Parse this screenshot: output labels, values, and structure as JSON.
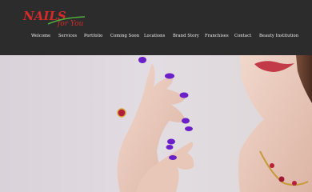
{
  "brand": {
    "logo_main": "NAILS",
    "logo_script": "for You",
    "colors": {
      "main": "#d42a2a",
      "script": "#4fae3c",
      "header_bg": "#2c2c2c"
    }
  },
  "nav": {
    "items": [
      {
        "label": "Welcome"
      },
      {
        "label": "Services"
      },
      {
        "label": "Portfolio"
      },
      {
        "label": "Coming Soon"
      },
      {
        "label": "Locations"
      },
      {
        "label": "Brand Story"
      },
      {
        "label": "Franchises"
      },
      {
        "label": "Contact"
      },
      {
        "label": "Beauty Institution"
      }
    ]
  },
  "hero": {
    "nail_color": "#6a1fc8",
    "lip_color": "#c23a48"
  }
}
